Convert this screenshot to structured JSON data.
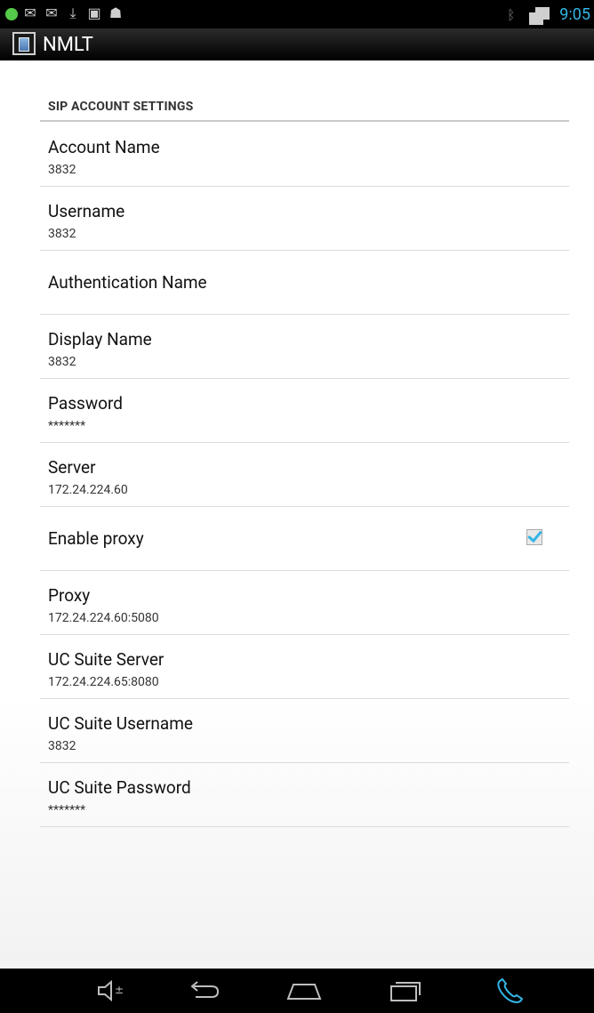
{
  "status_bar": {
    "time": "9:05",
    "icons": [
      "android-icon",
      "mail-icon",
      "mail-icon",
      "download-icon",
      "storage-icon",
      "android-icon"
    ]
  },
  "action_bar": {
    "title": "NMLT"
  },
  "section": {
    "header": "SIP ACCOUNT SETTINGS"
  },
  "preferences": [
    {
      "title": "Account Name",
      "summary": "3832"
    },
    {
      "title": "Username",
      "summary": "3832"
    },
    {
      "title": "Authentication Name",
      "summary": ""
    },
    {
      "title": "Display Name",
      "summary": "3832"
    },
    {
      "title": "Password",
      "summary": "*******"
    },
    {
      "title": "Server",
      "summary": "172.24.224.60"
    },
    {
      "title": "Enable proxy",
      "summary": "",
      "checked": true
    },
    {
      "title": "Proxy",
      "summary": "172.24.224.60:5080"
    },
    {
      "title": "UC Suite Server",
      "summary": "172.24.224.65:8080"
    },
    {
      "title": "UC Suite Username",
      "summary": "3832"
    },
    {
      "title": "UC Suite Password",
      "summary": "*******"
    }
  ],
  "colors": {
    "accent": "#33b5e5",
    "divider": "#dcdcdc"
  }
}
